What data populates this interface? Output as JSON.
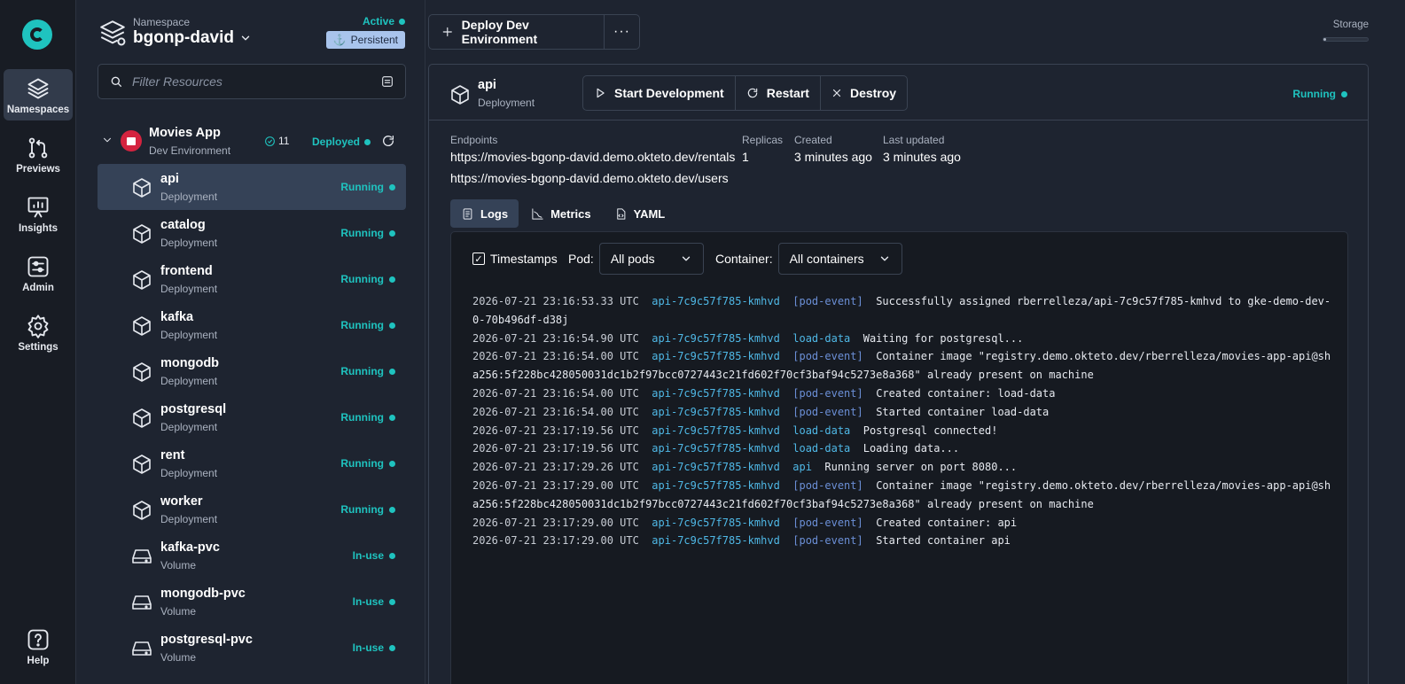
{
  "nav": {
    "items": [
      {
        "label": "Namespaces",
        "icon": "layers-icon",
        "active": true
      },
      {
        "label": "Previews",
        "icon": "pull-request-icon"
      },
      {
        "label": "Insights",
        "icon": "presentation-chart-icon"
      },
      {
        "label": "Admin",
        "icon": "sliders-icon"
      },
      {
        "label": "Settings",
        "icon": "gear-icon"
      }
    ],
    "help_label": "Help"
  },
  "namespace": {
    "caption": "Namespace",
    "name": "bgonp-david",
    "status": "Active",
    "badge": "Persistent"
  },
  "filter": {
    "placeholder": "Filter Resources"
  },
  "group": {
    "name": "Movies App",
    "subtitle": "Dev Environment",
    "count": "11",
    "status": "Deployed"
  },
  "resources": [
    {
      "name": "api",
      "type": "Deployment",
      "status": "Running",
      "icon": "cube-icon",
      "selected": true
    },
    {
      "name": "catalog",
      "type": "Deployment",
      "status": "Running",
      "icon": "cube-icon"
    },
    {
      "name": "frontend",
      "type": "Deployment",
      "status": "Running",
      "icon": "cube-icon"
    },
    {
      "name": "kafka",
      "type": "Deployment",
      "status": "Running",
      "icon": "cube-icon"
    },
    {
      "name": "mongodb",
      "type": "Deployment",
      "status": "Running",
      "icon": "cube-icon"
    },
    {
      "name": "postgresql",
      "type": "Deployment",
      "status": "Running",
      "icon": "cube-icon"
    },
    {
      "name": "rent",
      "type": "Deployment",
      "status": "Running",
      "icon": "cube-icon"
    },
    {
      "name": "worker",
      "type": "Deployment",
      "status": "Running",
      "icon": "cube-icon"
    },
    {
      "name": "kafka-pvc",
      "type": "Volume",
      "status": "In-use",
      "icon": "drive-icon"
    },
    {
      "name": "mongodb-pvc",
      "type": "Volume",
      "status": "In-use",
      "icon": "drive-icon"
    },
    {
      "name": "postgresql-pvc",
      "type": "Volume",
      "status": "In-use",
      "icon": "drive-icon"
    }
  ],
  "toolbar": {
    "deploy_label": "Deploy Dev Environment",
    "more_label": "···",
    "storage_label": "Storage",
    "storage_fraction": 0.06
  },
  "detail": {
    "name": "api",
    "type": "Deployment",
    "status": "Running",
    "actions": {
      "start": "Start Development",
      "restart": "Restart",
      "destroy": "Destroy"
    },
    "meta": {
      "endpoints_label": "Endpoints",
      "endpoint_1": "https://movies-bgonp-david.demo.okteto.dev/rentals",
      "endpoint_2": "https://movies-bgonp-david.demo.okteto.dev/users",
      "replicas_label": "Replicas",
      "replicas": "1",
      "created_label": "Created",
      "created": "3 minutes ago",
      "updated_label": "Last updated",
      "updated": "3 minutes ago"
    },
    "tabs": {
      "logs": "Logs",
      "metrics": "Metrics",
      "yaml": "YAML"
    }
  },
  "logs": {
    "timestamps_label": "Timestamps",
    "pod_label": "Pod:",
    "pod_value": "All pods",
    "container_label": "Container:",
    "container_value": "All containers",
    "lines": [
      {
        "ts": "2026-07-21 23:16:53.33 UTC",
        "pod": "api-7c9c57f785-kmhvd",
        "tag": "[pod-event]",
        "kind": "event",
        "msg": "Successfully assigned rberrelleza/api-7c9c57f785-kmhvd to gke-demo-dev-0-70b496df-d38j"
      },
      {
        "ts": "2026-07-21 23:16:54.90 UTC",
        "pod": "api-7c9c57f785-kmhvd",
        "tag": "load-data",
        "kind": "load",
        "msg": "Waiting for postgresql..."
      },
      {
        "ts": "2026-07-21 23:16:54.00 UTC",
        "pod": "api-7c9c57f785-kmhvd",
        "tag": "[pod-event]",
        "kind": "event",
        "msg": "Container image \"registry.demo.okteto.dev/rberrelleza/movies-app-api@sha256:5f228bc428050031dc1b2f97bcc0727443c21fd602f70cf3baf94c5273e8a368\" already present on machine"
      },
      {
        "ts": "2026-07-21 23:16:54.00 UTC",
        "pod": "api-7c9c57f785-kmhvd",
        "tag": "[pod-event]",
        "kind": "event",
        "msg": "Created container: load-data"
      },
      {
        "ts": "2026-07-21 23:16:54.00 UTC",
        "pod": "api-7c9c57f785-kmhvd",
        "tag": "[pod-event]",
        "kind": "event",
        "msg": "Started container load-data"
      },
      {
        "ts": "2026-07-21 23:17:19.56 UTC",
        "pod": "api-7c9c57f785-kmhvd",
        "tag": "load-data",
        "kind": "load",
        "msg": "Postgresql connected!"
      },
      {
        "ts": "2026-07-21 23:17:19.56 UTC",
        "pod": "api-7c9c57f785-kmhvd",
        "tag": "load-data",
        "kind": "load",
        "msg": "Loading data..."
      },
      {
        "ts": "2026-07-21 23:17:29.26 UTC",
        "pod": "api-7c9c57f785-kmhvd",
        "tag": "api",
        "kind": "api",
        "msg": "Running server on port 8080..."
      },
      {
        "ts": "2026-07-21 23:17:29.00 UTC",
        "pod": "api-7c9c57f785-kmhvd",
        "tag": "[pod-event]",
        "kind": "event",
        "msg": "Container image \"registry.demo.okteto.dev/rberrelleza/movies-app-api@sha256:5f228bc428050031dc1b2f97bcc0727443c21fd602f70cf3baf94c5273e8a368\" already present on machine"
      },
      {
        "ts": "2026-07-21 23:17:29.00 UTC",
        "pod": "api-7c9c57f785-kmhvd",
        "tag": "[pod-event]",
        "kind": "event",
        "msg": "Created container: api"
      },
      {
        "ts": "2026-07-21 23:17:29.00 UTC",
        "pod": "api-7c9c57f785-kmhvd",
        "tag": "[pod-event]",
        "kind": "event",
        "msg": "Started container api"
      }
    ]
  },
  "colors": {
    "accent": "#1fc3bf",
    "selected": "#354257",
    "badge": "#a9c4ec",
    "app_badge": "#d4233f"
  }
}
